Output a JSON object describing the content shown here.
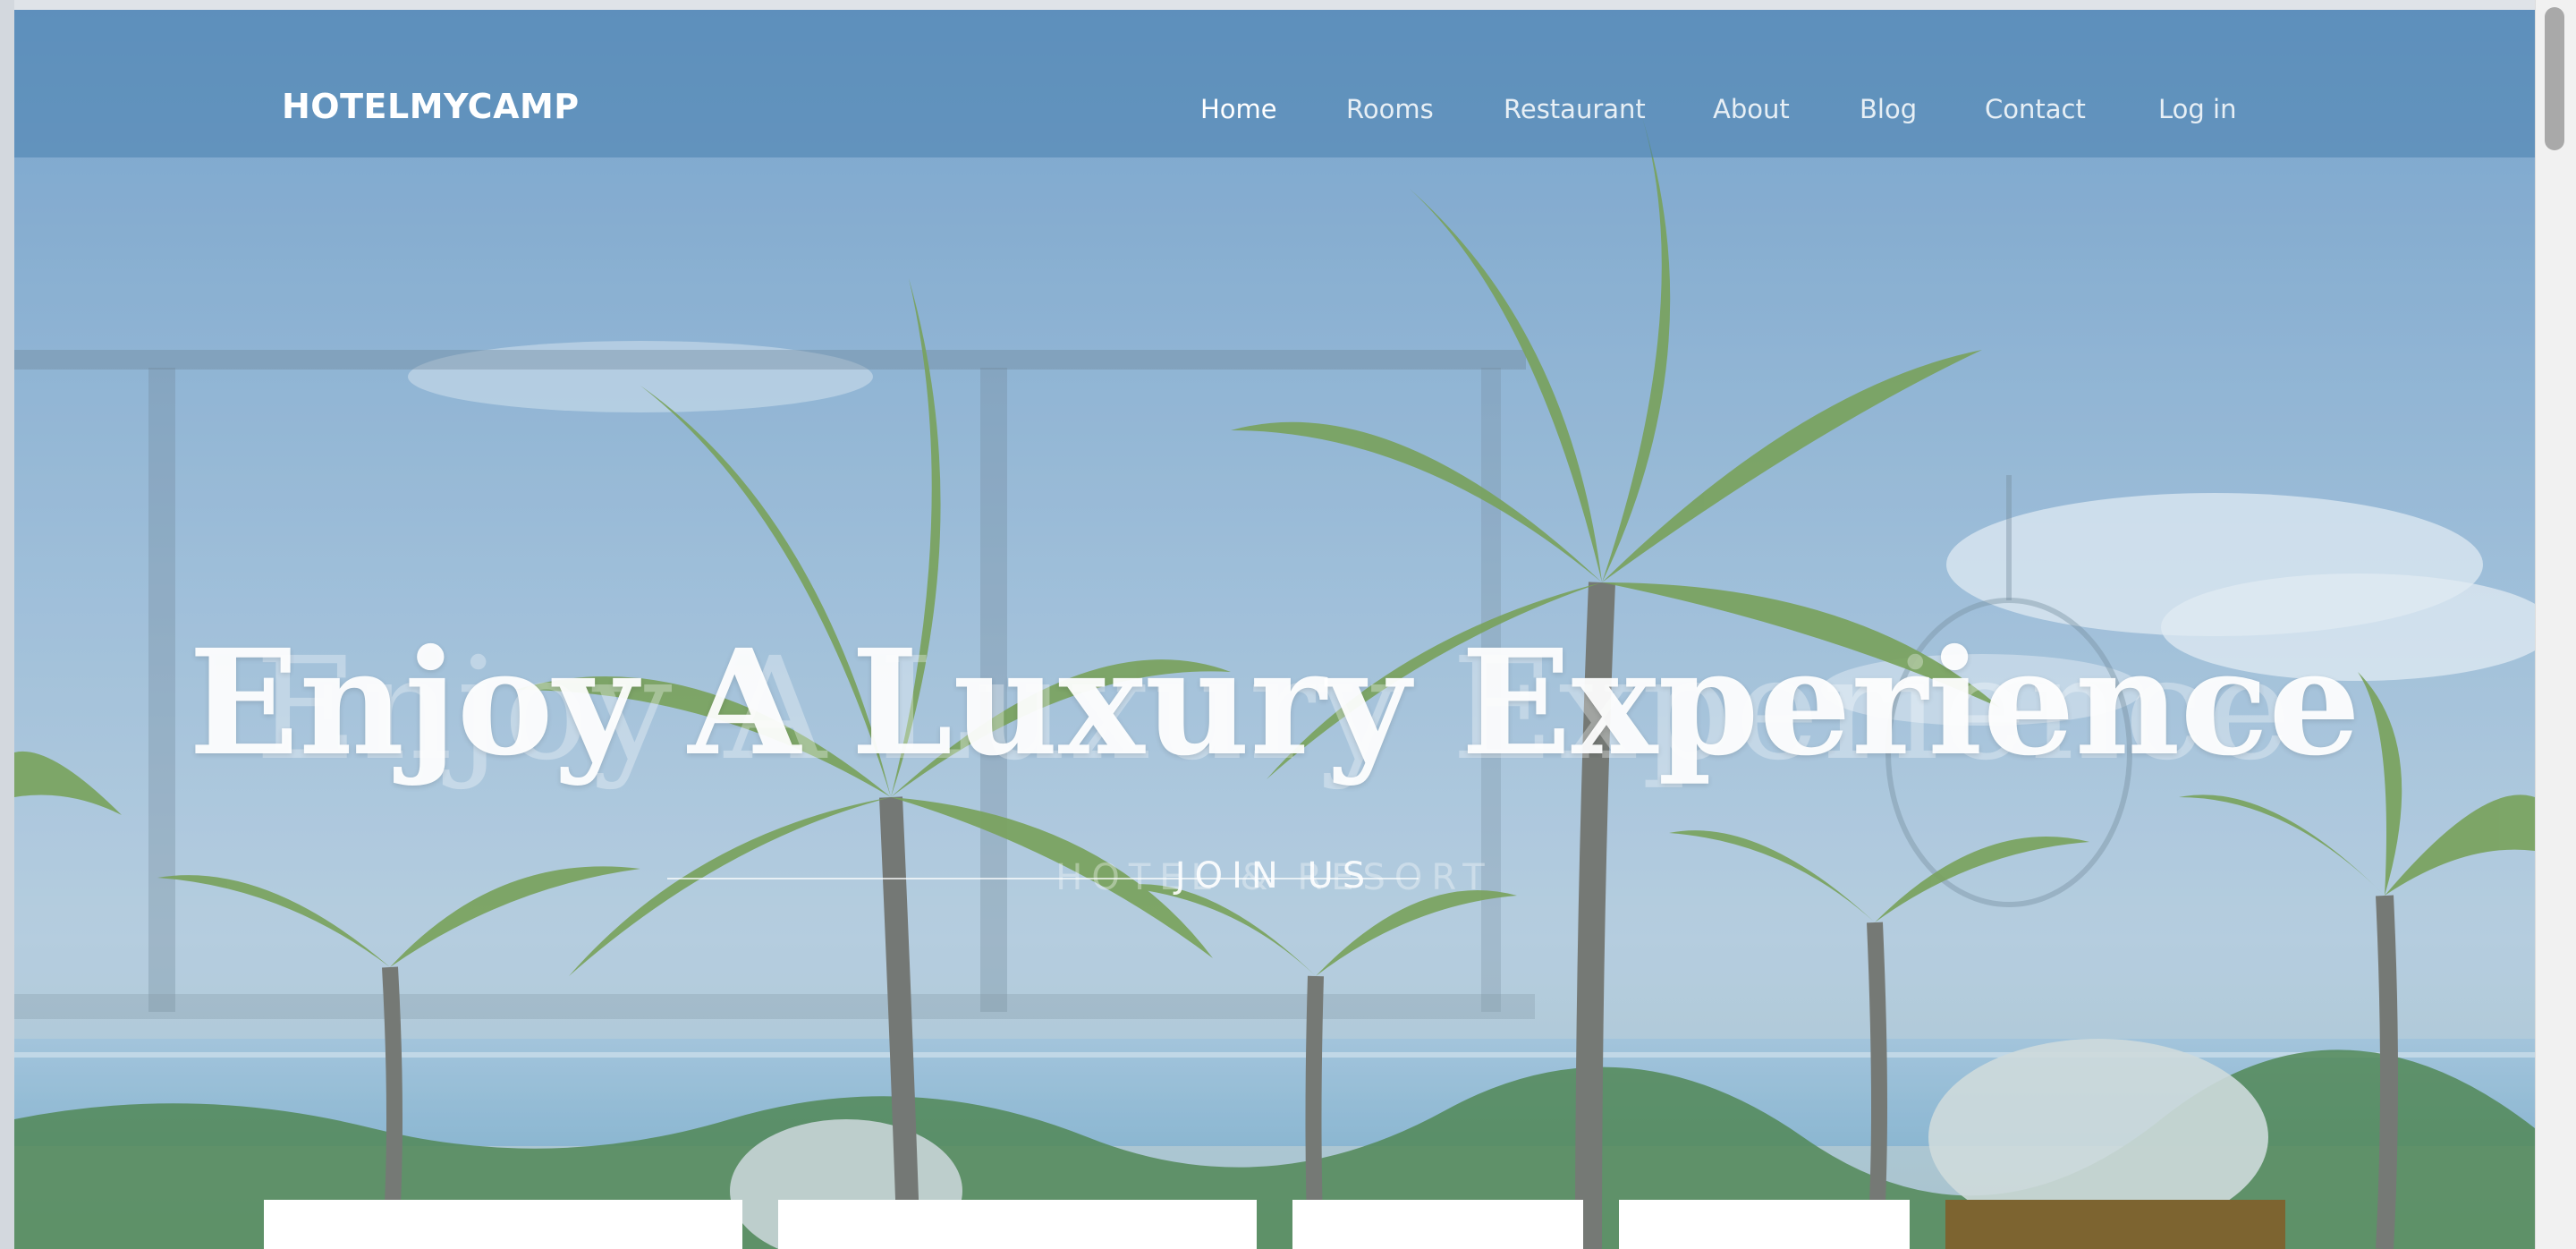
{
  "header": {
    "brand": "HOTELMYCAMP",
    "nav": [
      {
        "label": "Home",
        "active": true
      },
      {
        "label": "Rooms",
        "active": false
      },
      {
        "label": "Restaurant",
        "active": false
      },
      {
        "label": "About",
        "active": false
      },
      {
        "label": "Blog",
        "active": false
      },
      {
        "label": "Contact",
        "active": false
      },
      {
        "label": "Log in",
        "active": false
      }
    ]
  },
  "hero": {
    "title": "Enjoy A Luxury Experience",
    "subtitle": "JOIN US",
    "ghost_subtitle": "HOTEL & RESORT"
  },
  "booking": {
    "fields": [
      "",
      "",
      "",
      ""
    ],
    "submit_label": ""
  },
  "colors": {
    "header_overlay": "#4880af",
    "accent_button": "#7d6430",
    "sky": "#8ab1cf"
  }
}
